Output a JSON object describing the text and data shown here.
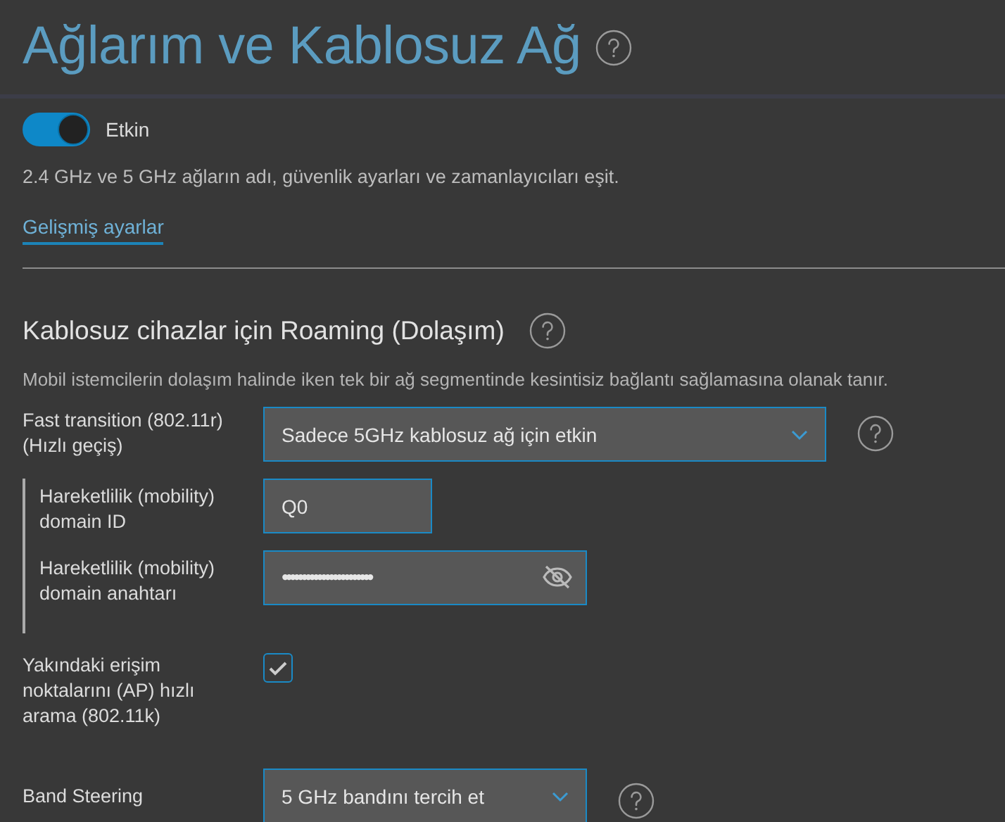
{
  "title": "Ağlarım ve Kablosuz Ağ",
  "smart_connect": {
    "on": true,
    "label": "Etkin"
  },
  "description": "2.4 GHz ve 5 GHz ağların adı, güvenlik ayarları ve zamanlayıcıları eşit.",
  "advanced_link": "Gelişmiş ayarlar",
  "roaming": {
    "title": "Kablosuz cihazlar için Roaming (Dolaşım)",
    "description": "Mobil istemcilerin dolaşım halinde iken tek bir ağ segmentinde kesintisiz bağlantı sağlamasına olanak tanır.",
    "fields": [
      {
        "kind": "select",
        "label": "Fast transition (802.11r) (Hızlı geçiş)",
        "value": "Sadece 5GHz kablosuz ağ için etkin",
        "children": [
          {
            "kind": "text",
            "label": "Hareketlilik (mobility) domain ID",
            "value": "Q0"
          },
          {
            "kind": "secret",
            "label": "Hareketlilik (mobility) domain anahtarı",
            "value": "•••••••••••••••••••••••"
          }
        ]
      },
      {
        "kind": "checkbox",
        "label": "Yakındaki erişim noktalarını (AP) hızlı arama (802.11k)",
        "checked": true
      },
      {
        "kind": "select",
        "label": "Band Steering",
        "value": "5 GHz bandını tercih et"
      }
    ]
  }
}
